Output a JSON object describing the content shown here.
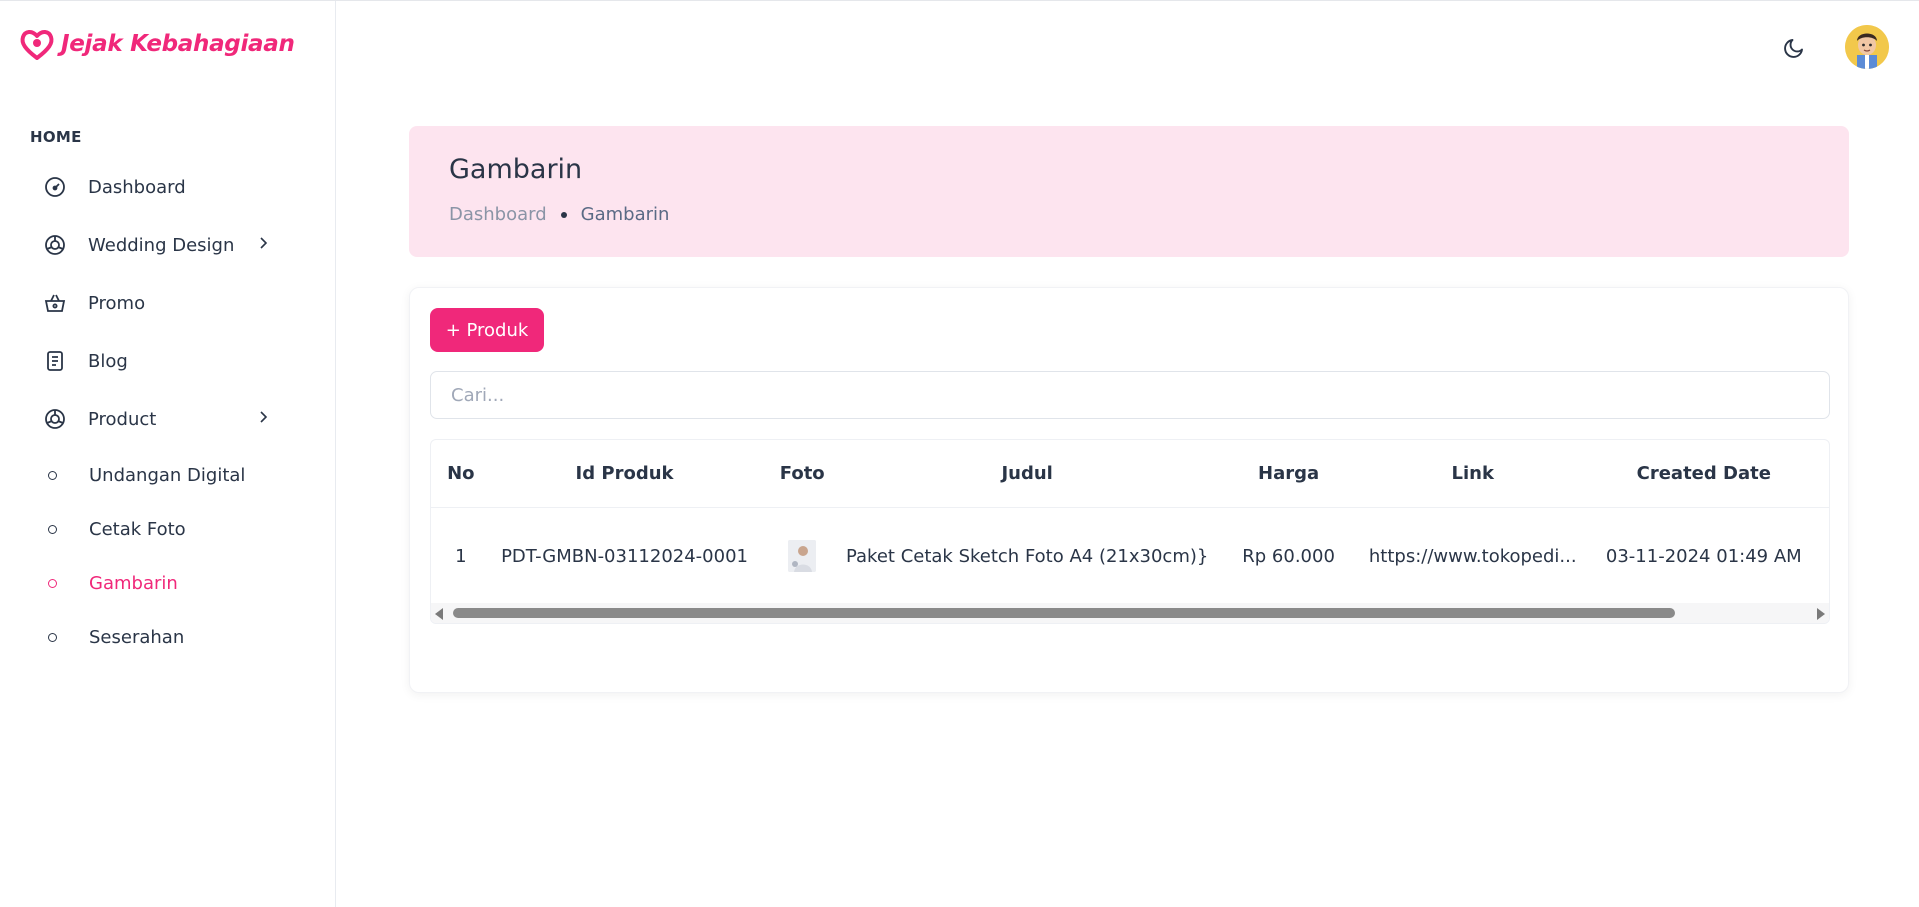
{
  "brand": {
    "name": "Jejak Kebahagiaan",
    "color": "#f0287a"
  },
  "sidebar": {
    "section_label": "HOME",
    "items": [
      {
        "label": "Dashboard",
        "icon": "gauge-icon"
      },
      {
        "label": "Wedding Design",
        "icon": "aperture-icon",
        "has_children": true
      },
      {
        "label": "Promo",
        "icon": "basket-icon"
      },
      {
        "label": "Blog",
        "icon": "document-icon"
      },
      {
        "label": "Product",
        "icon": "aperture-icon",
        "has_children": true
      }
    ],
    "sub_items": [
      {
        "label": "Undangan Digital",
        "active": false
      },
      {
        "label": "Cetak Foto",
        "active": false
      },
      {
        "label": "Gambarin",
        "active": true
      },
      {
        "label": "Seserahan",
        "active": false
      }
    ]
  },
  "topbar": {
    "theme_toggle_icon": "moon-icon",
    "avatar_icon": "user-avatar"
  },
  "page": {
    "title": "Gambarin",
    "breadcrumb": {
      "parent": "Dashboard",
      "current": "Gambarin"
    }
  },
  "toolbar": {
    "add_label": "+ Produk"
  },
  "search": {
    "placeholder": "Cari...",
    "value": ""
  },
  "table": {
    "columns": [
      "No",
      "Id Produk",
      "Foto",
      "Judul",
      "Harga",
      "Link",
      "Created Date"
    ],
    "rows": [
      {
        "no": "1",
        "id": "PDT-GMBN-03112024-0001",
        "photo": "product-thumbnail",
        "title": "Paket Cetak Sketch Foto A4 (21x30cm)}",
        "price": "Rp 60.000",
        "link": "https://www.tokopedi...",
        "created": "03-11-2024 01:49 AM"
      }
    ]
  },
  "scroll": {
    "horizontal_position": 0.0
  }
}
